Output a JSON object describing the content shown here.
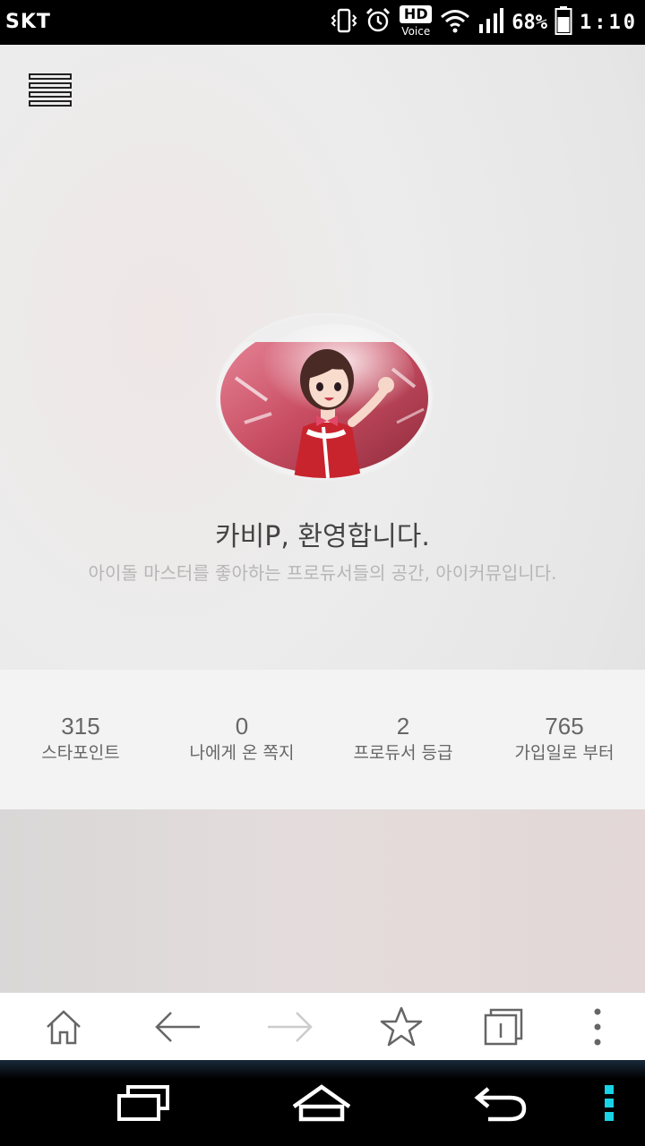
{
  "status_bar": {
    "carrier": "SKT",
    "hd_label": "HD",
    "voice_label": "Voice",
    "battery": "68%",
    "time": "1:10",
    "icons": [
      "vibrate-icon",
      "alarm-icon",
      "hd-voice-icon",
      "wifi-icon",
      "signal-icon",
      "battery-icon"
    ]
  },
  "header": {
    "menu_icon": "hamburger-menu-icon"
  },
  "profile": {
    "welcome": "카비P, 환영합니다.",
    "subtitle": "아이돌 마스터를 좋아하는 프로듀서들의 공간, 아이커뮤입니다."
  },
  "stats": [
    {
      "value": "315",
      "label": "스타포인트"
    },
    {
      "value": "0",
      "label": "나에게 온 쪽지"
    },
    {
      "value": "2",
      "label": "프로듀서 등급"
    },
    {
      "value": "765",
      "label": "가입일로 부터"
    }
  ],
  "toolbar": {
    "buttons": [
      "home-icon",
      "back-arrow-icon",
      "forward-arrow-icon",
      "bookmark-star-icon",
      "tabs-icon",
      "more-menu-icon"
    ]
  },
  "nav_bar": {
    "buttons": [
      "recent-apps-icon",
      "home-icon",
      "back-icon",
      "menu-icon"
    ],
    "accent": "#19d3e6"
  }
}
